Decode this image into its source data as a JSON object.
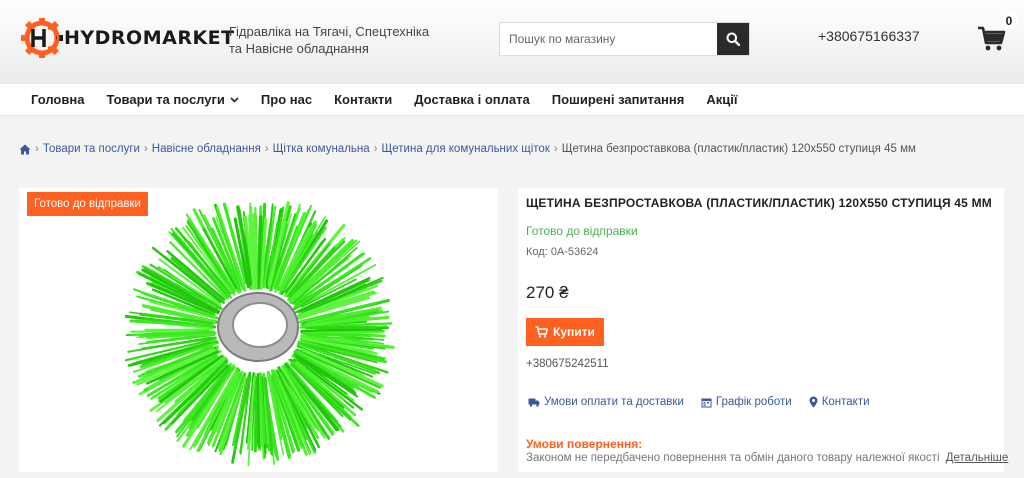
{
  "header": {
    "logo_text": "HYDROMARKET",
    "tagline": "Гідравліка на Тягачі, Спецтехніка та Навісне обладнання",
    "search_placeholder": "Пошук по магазину",
    "phone": "+380675166337",
    "cart_count": "0",
    "brand_color": "#ff5f1f"
  },
  "nav": {
    "items": [
      "Головна",
      "Товари та послуги",
      "Про нас",
      "Контакти",
      "Доставка і оплата",
      "Поширені запитання",
      "Акції"
    ]
  },
  "breadcrumb": {
    "home_icon": "home-icon",
    "links": [
      "Товари та послуги",
      "Навісне обладнання",
      "Щітка комунальна",
      "Щетина для комунальних щіток"
    ],
    "current": "Щетина безпроставкова (пластик/пластик) 120х550 ступиця 45 мм"
  },
  "product": {
    "badge": "Готово до відправки",
    "title": "ЩЕТИНА БЕЗПРОСТАВКОВА (ПЛАСТИК/ПЛАСТИК) 120Х550 СТУПИЦЯ 45 ММ",
    "stock": "Готово до відправки",
    "code": "Код: 0А-53624",
    "price": "270 ₴",
    "buy_label": "Купити",
    "phone": "+380675242511",
    "links": [
      "Умови оплати та доставки",
      "Графік роботи",
      "Контакти"
    ],
    "return_title": "Умови повернення:",
    "return_text": "Законом не передбачено повернення та обмін даного товару належної якості",
    "return_more": "Детальніше"
  }
}
